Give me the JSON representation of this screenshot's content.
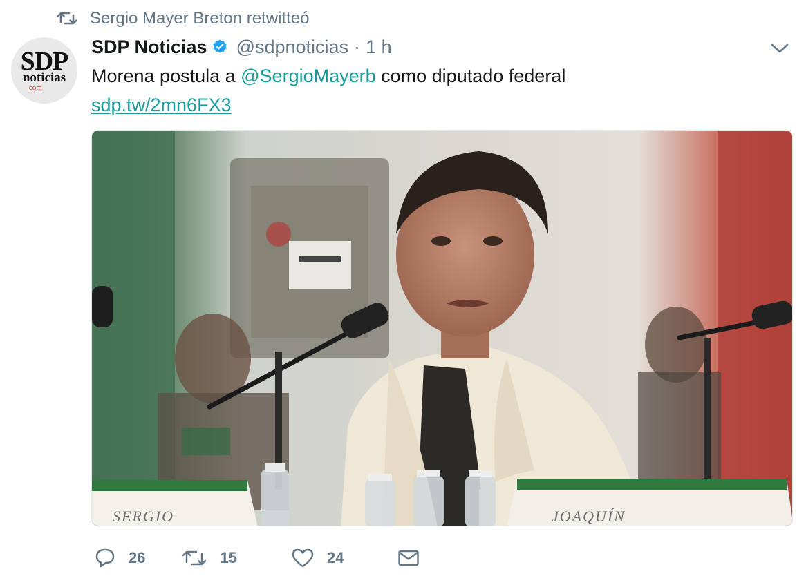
{
  "retweet": {
    "text": "Sergio Mayer Breton retwitteó"
  },
  "author": {
    "avatar_line1": "SDP",
    "avatar_line2": "noticias",
    "avatar_line3": ".com",
    "name": "SDP Noticias",
    "handle": "@sdpnoticias",
    "separator": "·",
    "time": "1 h"
  },
  "tweet": {
    "text_before": "Morena postula a ",
    "mention": "@SergioMayerb",
    "text_after": " como diputado federal",
    "link": "sdp.tw/2mn6FX3"
  },
  "media": {
    "nameplate_left": "SERGIO",
    "nameplate_right": "JOAQUÍN"
  },
  "actions": {
    "replies": "26",
    "retweets": "15",
    "likes": "24"
  },
  "colors": {
    "link": "#1a9b9b",
    "verified": "#1da1f2",
    "muted": "#657786"
  }
}
